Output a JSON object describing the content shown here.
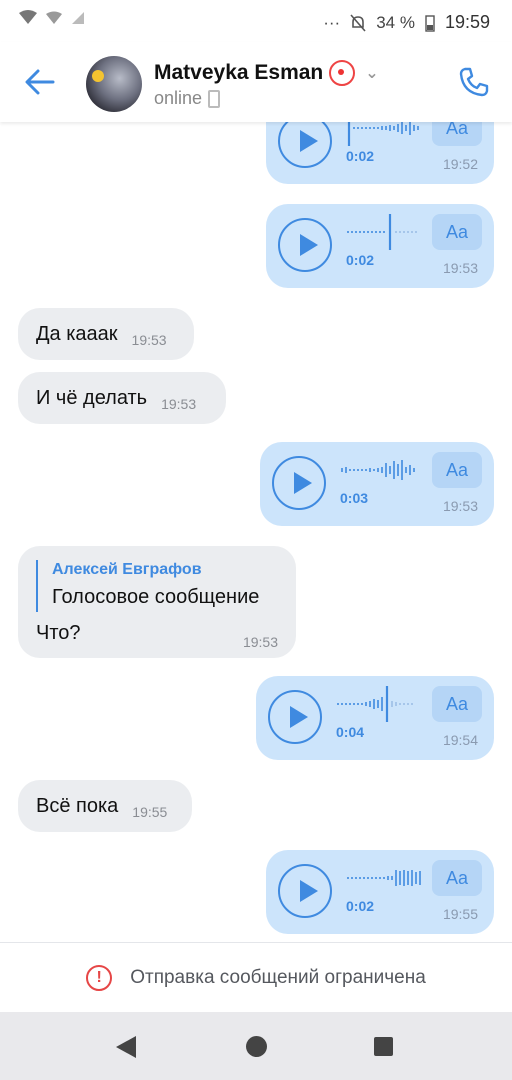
{
  "status_bar": {
    "battery": "34 %",
    "time": "19:59",
    "icons": [
      "signal-icon",
      "wifi-icon",
      "mute-icon",
      "battery-icon"
    ]
  },
  "header": {
    "name": "Matveyka Esman",
    "emoji": "clown-face-icon",
    "status": "online",
    "icons": [
      "back-arrow-icon",
      "chevron-down-icon",
      "phone-call-icon"
    ]
  },
  "messages": [
    {
      "type": "voice-out",
      "duration": "0:02",
      "aa": "Aa",
      "time": "19:52"
    },
    {
      "type": "voice-out",
      "duration": "0:02",
      "aa": "Aa",
      "time": "19:53"
    },
    {
      "type": "text-in",
      "text": "Да кааак",
      "time": "19:53"
    },
    {
      "type": "text-in",
      "text": "И чё делать",
      "time": "19:53"
    },
    {
      "type": "voice-out",
      "duration": "0:03",
      "aa": "Aa",
      "time": "19:53"
    },
    {
      "type": "reply-in",
      "quote_author": "Алексей Евграфов",
      "quote_text": "Голосовое сообщение",
      "text": "Что?",
      "time": "19:53"
    },
    {
      "type": "voice-out",
      "duration": "0:04",
      "aa": "Aa",
      "time": "19:54"
    },
    {
      "type": "text-in",
      "text": "Всё пока",
      "time": "19:55"
    },
    {
      "type": "voice-out",
      "duration": "0:02",
      "aa": "Aa",
      "time": "19:55"
    }
  ],
  "restriction": {
    "text": "Отправка сообщений ограничена"
  },
  "colors": {
    "accent": "#3f8ae0",
    "outgoing_bubble": "#cce4fb",
    "incoming_bubble": "#ebedf0",
    "warning": "#e64646"
  }
}
